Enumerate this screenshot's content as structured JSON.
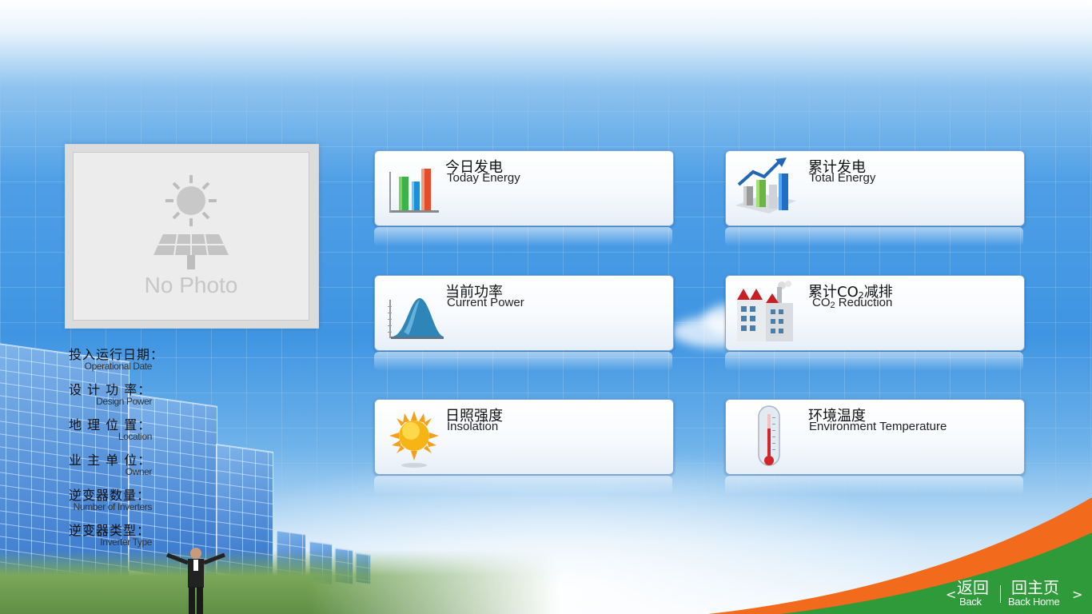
{
  "photo": {
    "placeholder_text": "No Photo"
  },
  "info": [
    {
      "zh": "投入运行日期：",
      "en": "Operational Date"
    },
    {
      "zh": "设 计 功 率：",
      "en": "Design Power"
    },
    {
      "zh": "地 理 位 置：",
      "en": "Location"
    },
    {
      "zh": "业 主 单 位：",
      "en": "Owner"
    },
    {
      "zh": "逆变器数量：",
      "en": "Number of Inverters"
    },
    {
      "zh": "逆变器类型：",
      "en": "Inverter Type"
    }
  ],
  "cards": {
    "today_energy": {
      "zh": "今日发电",
      "en": "Today Energy",
      "icon": "bar-chart-icon"
    },
    "total_energy": {
      "zh": "累计发电",
      "en": "Total Energy",
      "icon": "growth-chart-icon"
    },
    "current_power": {
      "zh": "当前功率",
      "en": "Current Power",
      "icon": "bell-curve-icon"
    },
    "co2_reduction": {
      "zh_pre": "累计CO",
      "zh_sub": "2",
      "zh_post": "减排",
      "en_pre": "CO",
      "en_sub": "2",
      "en_post": " Reduction",
      "icon": "factory-icon"
    },
    "insolation": {
      "zh": "日照强度",
      "en": "Insolation",
      "icon": "sun-icon"
    },
    "environment_temperature": {
      "zh": "环境温度",
      "en": "Environment Temperature",
      "icon": "thermometer-icon"
    }
  },
  "nav": {
    "back_zh": "返回",
    "back_en": "Back",
    "home_zh": "回主页",
    "home_en": "Back Home",
    "left_arrow": "<",
    "right_arrow": ">"
  },
  "colors": {
    "accent_blue": "#3f95e2",
    "swoosh_orange": "#f26b1d",
    "swoosh_green": "#2f9a3a"
  }
}
